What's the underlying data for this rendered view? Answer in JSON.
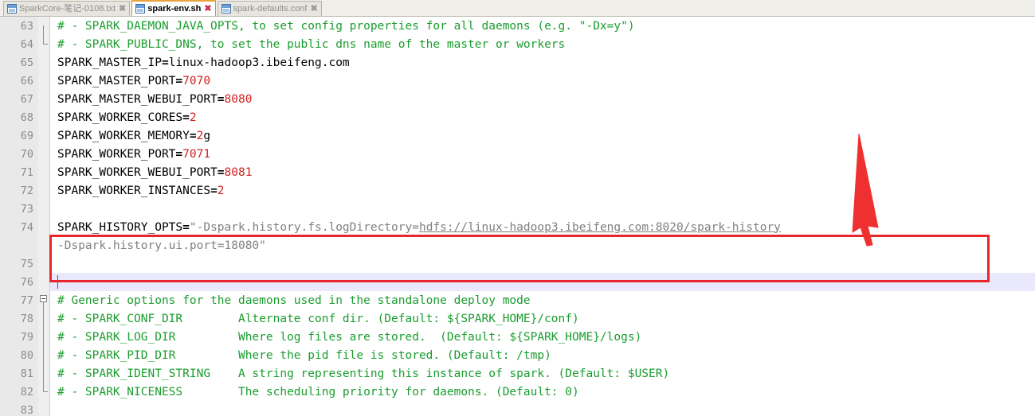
{
  "window": {
    "app_type": "text-editor",
    "accent_color": "#e8a33d",
    "annotation_color": "#e8262b"
  },
  "tabbar": {
    "tabs": [
      {
        "label": "SparkCore-笔记-0108.txt",
        "active": false,
        "close_label": "✖",
        "icon": "file-icon"
      },
      {
        "label": "spark-env.sh",
        "active": true,
        "close_label": "✖",
        "icon": "file-icon"
      },
      {
        "label": "spark-defaults.conf",
        "active": false,
        "close_label": "✖",
        "icon": "file-icon"
      }
    ]
  },
  "editor": {
    "current_line": 76,
    "first_visible_line": 63,
    "last_visible_line": 83,
    "lines": [
      {
        "number": "63",
        "fold": "line-bottom",
        "segments": [
          {
            "text": "# - SPARK_DAEMON_JAVA_OPTS, to set config properties for all daemons (e.g. \"-Dx=y\")",
            "style": "comment"
          }
        ]
      },
      {
        "number": "64",
        "fold": "elbow-end",
        "segments": [
          {
            "text": "# - SPARK_PUBLIC_DNS, to set the public dns name of the master or workers",
            "style": "comment"
          }
        ]
      },
      {
        "number": "65",
        "fold": "none",
        "segments": [
          {
            "text": "SPARK_MASTER_IP",
            "style": "plain"
          },
          {
            "text": "=",
            "style": "operator"
          },
          {
            "text": "linux-hadoop3.ibeifeng.com",
            "style": "plain"
          }
        ]
      },
      {
        "number": "66",
        "fold": "none",
        "segments": [
          {
            "text": "SPARK_MASTER_PORT",
            "style": "plain"
          },
          {
            "text": "=",
            "style": "operator"
          },
          {
            "text": "7070",
            "style": "number"
          }
        ]
      },
      {
        "number": "67",
        "fold": "none",
        "segments": [
          {
            "text": "SPARK_MASTER_WEBUI_PORT",
            "style": "plain"
          },
          {
            "text": "=",
            "style": "operator"
          },
          {
            "text": "8080",
            "style": "number"
          }
        ]
      },
      {
        "number": "68",
        "fold": "none",
        "segments": [
          {
            "text": "SPARK_WORKER_CORES",
            "style": "plain"
          },
          {
            "text": "=",
            "style": "operator"
          },
          {
            "text": "2",
            "style": "number"
          }
        ]
      },
      {
        "number": "69",
        "fold": "none",
        "segments": [
          {
            "text": "SPARK_WORKER_MEMORY",
            "style": "plain"
          },
          {
            "text": "=",
            "style": "operator"
          },
          {
            "text": "2",
            "style": "number"
          },
          {
            "text": "g",
            "style": "plain"
          }
        ]
      },
      {
        "number": "70",
        "fold": "none",
        "segments": [
          {
            "text": "SPARK_WORKER_PORT",
            "style": "plain"
          },
          {
            "text": "=",
            "style": "operator"
          },
          {
            "text": "7071",
            "style": "number"
          }
        ]
      },
      {
        "number": "71",
        "fold": "none",
        "segments": [
          {
            "text": "SPARK_WORKER_WEBUI_PORT",
            "style": "plain"
          },
          {
            "text": "=",
            "style": "operator"
          },
          {
            "text": "8081",
            "style": "number"
          }
        ]
      },
      {
        "number": "72",
        "fold": "none",
        "segments": [
          {
            "text": "SPARK_WORKER_INSTANCES",
            "style": "plain"
          },
          {
            "text": "=",
            "style": "operator"
          },
          {
            "text": "2",
            "style": "number"
          }
        ]
      },
      {
        "number": "73",
        "fold": "none",
        "segments": []
      },
      {
        "number": "74",
        "fold": "none",
        "segments": [
          {
            "text": "SPARK_HISTORY_OPTS",
            "style": "plain"
          },
          {
            "text": "=",
            "style": "operator"
          },
          {
            "text": "\"-Dspark.history.fs.logDirectory=",
            "style": "string"
          },
          {
            "text": "hdfs://linux-hadoop3.ibeifeng.com:8020/spark-history",
            "style": "link"
          }
        ]
      },
      {
        "number": "",
        "fold": "none",
        "segments": [
          {
            "text": "-Dspark.history.ui.port=18080\"",
            "style": "string"
          }
        ]
      },
      {
        "number": "75",
        "fold": "none",
        "segments": []
      },
      {
        "number": "76",
        "fold": "none",
        "current": true,
        "cursor": true,
        "segments": []
      },
      {
        "number": "77",
        "fold": "box-minus",
        "segments": [
          {
            "text": "# Generic options for the daemons used in the standalone deploy mode",
            "style": "comment"
          }
        ]
      },
      {
        "number": "78",
        "fold": "line",
        "segments": [
          {
            "text": "# - SPARK_CONF_DIR        Alternate conf dir. (Default: ${SPARK_HOME}/conf)",
            "style": "comment"
          }
        ]
      },
      {
        "number": "79",
        "fold": "line",
        "segments": [
          {
            "text": "# - SPARK_LOG_DIR         Where log files are stored.  (Default: ${SPARK_HOME}/logs)",
            "style": "comment"
          }
        ]
      },
      {
        "number": "80",
        "fold": "line",
        "segments": [
          {
            "text": "# - SPARK_PID_DIR         Where the pid file is stored. (Default: /tmp)",
            "style": "comment"
          }
        ]
      },
      {
        "number": "81",
        "fold": "line",
        "segments": [
          {
            "text": "# - SPARK_IDENT_STRING    A string representing this instance of spark. (Default: $USER)",
            "style": "comment"
          }
        ]
      },
      {
        "number": "82",
        "fold": "elbow-end",
        "segments": [
          {
            "text": "# - SPARK_NICENESS        The scheduling priority for daemons. (Default: 0)",
            "style": "comment"
          }
        ]
      },
      {
        "number": "83",
        "fold": "none",
        "segments": []
      }
    ]
  },
  "annotations": {
    "highlight_box": {
      "target_line": "74",
      "color": "#e8262b"
    },
    "arrow": {
      "direction": "down",
      "color": "#e8262b",
      "points_to": "spark-history"
    }
  }
}
